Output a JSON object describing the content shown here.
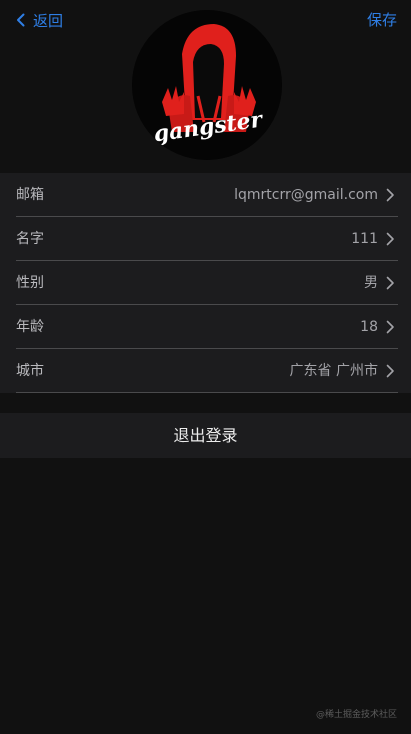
{
  "nav": {
    "back_icon": "chevron-left-icon",
    "back_label": "返回",
    "save_label": "保存",
    "accent_color": "#2f7fe6"
  },
  "avatar": {
    "text": "gangster",
    "hood_color": "#e0201c"
  },
  "profile": {
    "rows": [
      {
        "label": "邮箱",
        "value": "lqmrtcrr@gmail.com"
      },
      {
        "label": "名字",
        "value": "111"
      },
      {
        "label": "性别",
        "value": "男"
      },
      {
        "label": "年龄",
        "value": "18"
      },
      {
        "label": "城市",
        "value": "广东省 广州市"
      }
    ]
  },
  "logout": {
    "label": "退出登录"
  },
  "watermark": "@稀土掘金技术社区"
}
